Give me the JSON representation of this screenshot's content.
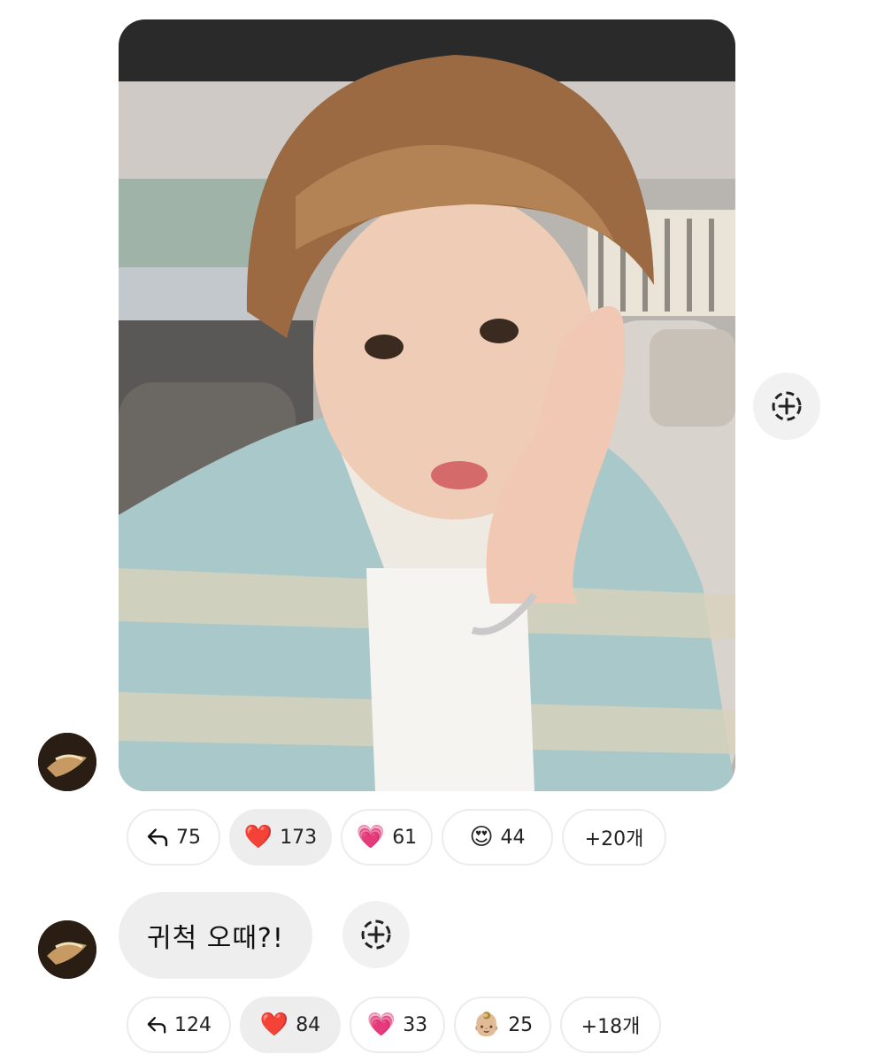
{
  "message_photo": {
    "alt": "selfie photo in car",
    "reactions": {
      "reply_count": "75",
      "items": [
        {
          "emoji": "❤️",
          "name": "red-heart",
          "count": "173"
        },
        {
          "emoji": "💗",
          "name": "pink-heart",
          "count": "61"
        },
        {
          "emoji": "😍",
          "name": "heart-eyes",
          "count": "44"
        }
      ],
      "more_label": "+20개"
    }
  },
  "message_text": {
    "text": "귀척 오때?!",
    "reactions": {
      "reply_count": "124",
      "items": [
        {
          "emoji": "❤️",
          "name": "red-heart",
          "count": "84"
        },
        {
          "emoji": "💗",
          "name": "pink-heart",
          "count": "33"
        },
        {
          "emoji": "👶🏼",
          "name": "baby",
          "count": "25"
        }
      ],
      "more_label": "+18개"
    }
  },
  "colors": {
    "chip_border": "#ececec",
    "chip_active_bg": "#ededed",
    "bubble_bg": "#eeeeee"
  },
  "icons": {
    "reply": "reply-arrow-icon",
    "add_reaction": "add-reaction-icon"
  }
}
